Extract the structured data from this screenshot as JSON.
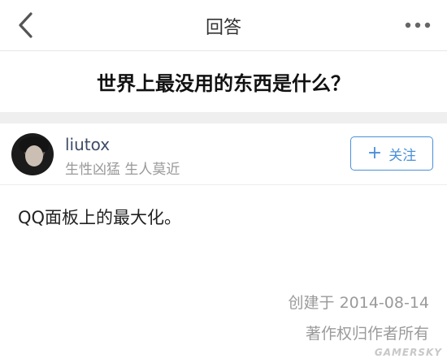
{
  "nav": {
    "title": "回答",
    "back_icon": "chevron-left-icon",
    "more_icon": "more-dots-icon"
  },
  "question": {
    "title": "世界上最没用的东西是什么？"
  },
  "author": {
    "name": "liutox",
    "bio": "生性凶猛 生人莫近",
    "follow_label": "关注",
    "follow_icon": "plus-icon"
  },
  "answer": {
    "text": "QQ面板上的最大化。",
    "created": "创建于 2014-08-14",
    "copyright": "著作权归作者所有"
  },
  "watermark": {
    "text": "GAMERSKY"
  },
  "colors": {
    "accent": "#4a90d9",
    "author_name": "#3d4c68",
    "muted": "#999999"
  }
}
